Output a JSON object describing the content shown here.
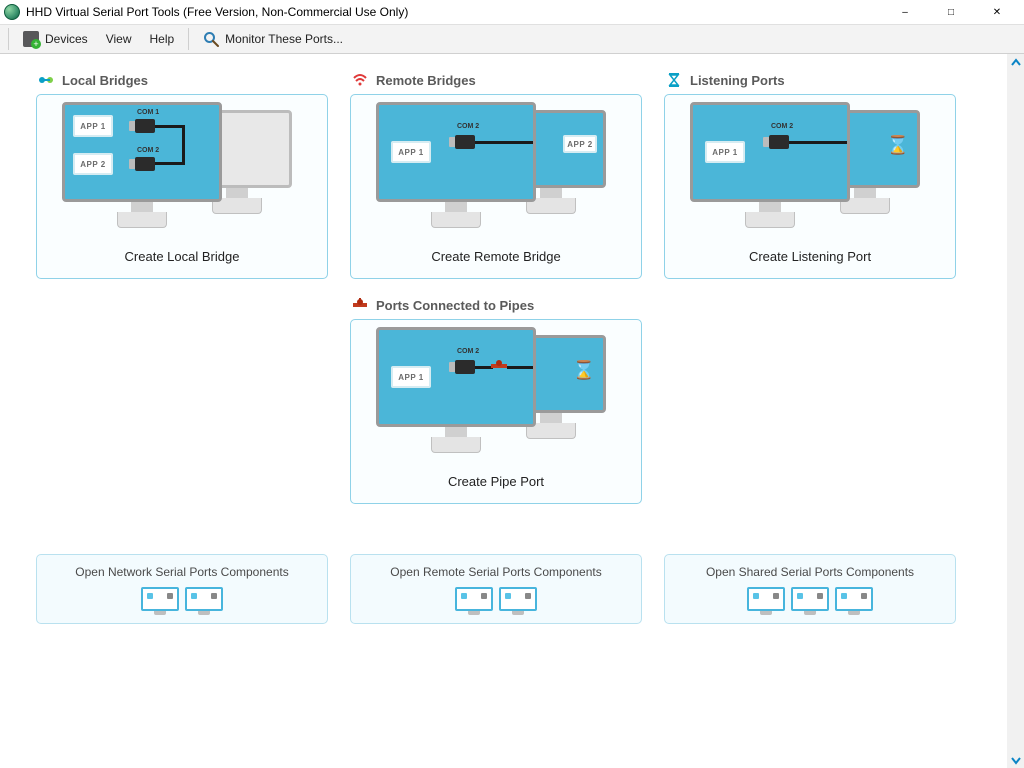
{
  "window": {
    "title": "HHD Virtual Serial Port Tools (Free Version, Non-Commercial Use Only)"
  },
  "menubar": {
    "devices": "Devices",
    "view": "View",
    "help": "Help",
    "monitor": "Monitor These Ports..."
  },
  "sections": {
    "local_bridges": {
      "header": "Local Bridges",
      "action": "Create Local Bridge",
      "app1": "APP 1",
      "app2": "APP 2",
      "com1": "COM 1",
      "com2": "COM 2"
    },
    "remote_bridges": {
      "header": "Remote Bridges",
      "action": "Create Remote Bridge",
      "app1": "APP 1",
      "app2": "APP 2",
      "com2": "COM 2"
    },
    "listening_ports": {
      "header": "Listening Ports",
      "action": "Create Listening Port",
      "app1": "APP 1",
      "com2": "COM 2"
    },
    "pipes": {
      "header": "Ports Connected to Pipes",
      "action": "Create Pipe Port",
      "app1": "APP 1",
      "com2": "COM 2"
    }
  },
  "components": {
    "network": "Open Network Serial Ports Components",
    "remote": "Open Remote Serial Ports Components",
    "shared": "Open Shared Serial Ports Components"
  }
}
